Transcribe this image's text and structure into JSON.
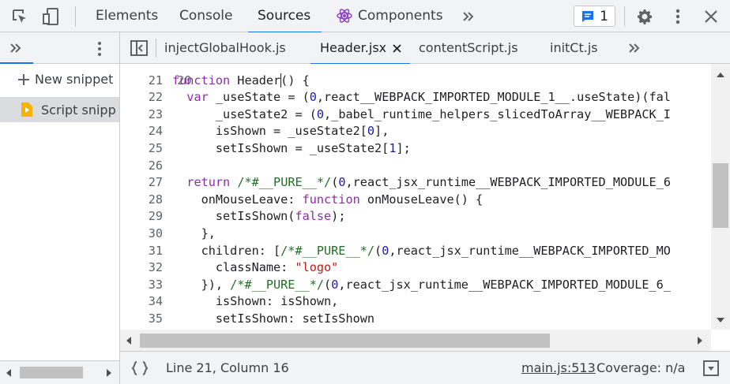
{
  "toolbar": {
    "tabs": [
      {
        "label": "Elements"
      },
      {
        "label": "Console"
      },
      {
        "label": "Sources"
      },
      {
        "label": "Components"
      }
    ],
    "issues_count": "1",
    "colors": {
      "accent": "#1a73e8",
      "toolbar_bg": "#f1f3f4"
    }
  },
  "sidebar": {
    "new_snippet_label": "New snippet",
    "snippet_item_label": "Script snipp"
  },
  "editor": {
    "tabs": [
      {
        "label": "injectGlobalHook.js"
      },
      {
        "label": "Header.jsx"
      },
      {
        "label": "contentScript.js"
      },
      {
        "label": "initCt.js"
      }
    ],
    "partial_line_number": "20",
    "line_numbers": [
      "21",
      "22",
      "23",
      "24",
      "25",
      "26",
      "27",
      "28",
      "29",
      "30",
      "31",
      "32",
      "33",
      "34",
      "35"
    ],
    "lines": [
      "function Header() {",
      "  var _useState = (0,react__WEBPACK_IMPORTED_MODULE_1__.useState)(fal",
      "      _useState2 = (0,_babel_runtime_helpers_slicedToArray__WEBPACK_I",
      "      isShown = _useState2[0],",
      "      setIsShown = _useState2[1];",
      "",
      "  return /*#__PURE__*/(0,react_jsx_runtime__WEBPACK_IMPORTED_MODULE_6",
      "    onMouseLeave: function onMouseLeave() {",
      "      setIsShown(false);",
      "    },",
      "    children: [/*#__PURE__*/(0,react_jsx_runtime__WEBPACK_IMPORTED_MO",
      "      className: \"logo\"",
      "    }), /*#__PURE__*/(0,react_jsx_runtime__WEBPACK_IMPORTED_MODULE_6_",
      "      isShown: isShown,",
      "      setIsShown: setIsShown"
    ]
  },
  "status": {
    "position": "Line 21, Column 16",
    "source_location": "main.js:513",
    "coverage": "Coverage: n/a"
  }
}
